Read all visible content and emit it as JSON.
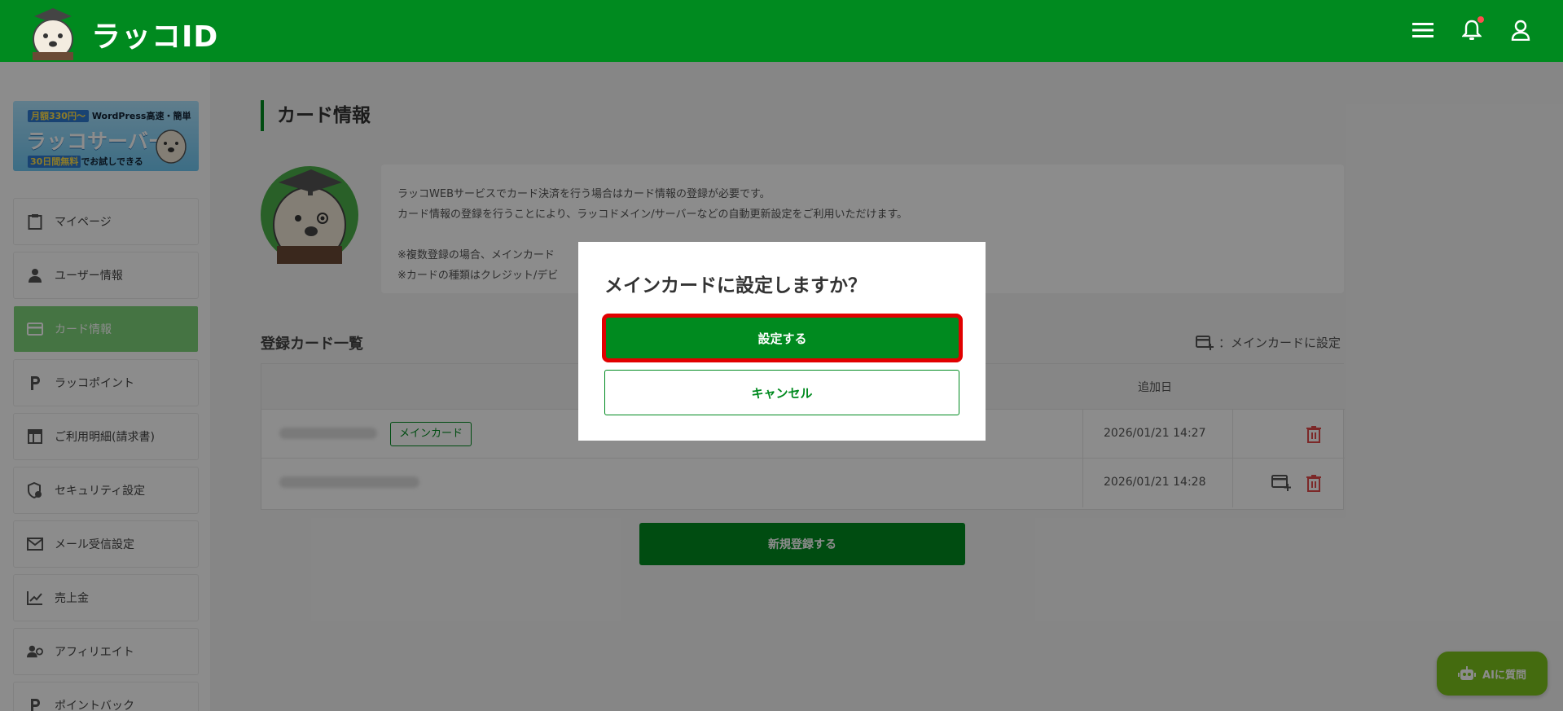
{
  "header": {
    "logo_text": "ラッコID",
    "menu_icon": "hamburger-menu-icon",
    "bell_icon": "bell-icon",
    "user_icon": "user-icon",
    "brand_color": "#008a1f"
  },
  "sidebar": {
    "banner": {
      "line1_pill": "月額330円〜",
      "line1_text": "WordPress高速・簡単",
      "line2": "ラッコサーバー",
      "line3_pill": "30日間無料",
      "line3_text": "でお試しできる"
    },
    "items": [
      {
        "label": "マイページ",
        "icon": "clipboard-icon"
      },
      {
        "label": "ユーザー情報",
        "icon": "person-icon"
      },
      {
        "label": "カード情報",
        "icon": "credit-card-icon",
        "active": true
      },
      {
        "label": "ラッコポイント",
        "icon": "point-icon"
      },
      {
        "label": "ご利用明細(請求書)",
        "icon": "table-icon"
      },
      {
        "label": "セキュリティ設定",
        "icon": "shield-gear-icon"
      },
      {
        "label": "メール受信設定",
        "icon": "mail-icon"
      },
      {
        "label": "売上金",
        "icon": "chart-icon"
      },
      {
        "label": "アフィリエイト",
        "icon": "people-icon"
      },
      {
        "label": "ポイントバック",
        "icon": "point-icon"
      }
    ]
  },
  "main": {
    "title": "カード情報",
    "info_lines": [
      "ラッコWEBサービスでカード決済を行う場合はカード情報の登録が必要です。",
      "カード情報の登録を行うことにより、ラッコドメイン/サーバーなどの自動更新設定をご利用いただけます。",
      "",
      "※複数登録の場合、メインカード",
      "※カードの種類はクレジット/デビ"
    ],
    "list_title": "登録カード一覧",
    "legend_text": "：メインカードに設定",
    "table": {
      "header_date": "追加日",
      "rows": [
        {
          "tag": "メインカード",
          "date": "2026/01/21 14:27"
        },
        {
          "tag": "",
          "date": "2026/01/21 14:28"
        }
      ]
    },
    "new_button": "新規登録する"
  },
  "ai_button": "AIに質問",
  "modal": {
    "title": "メインカードに設定しますか？",
    "confirm": "設定する",
    "cancel": "キャンセル"
  }
}
